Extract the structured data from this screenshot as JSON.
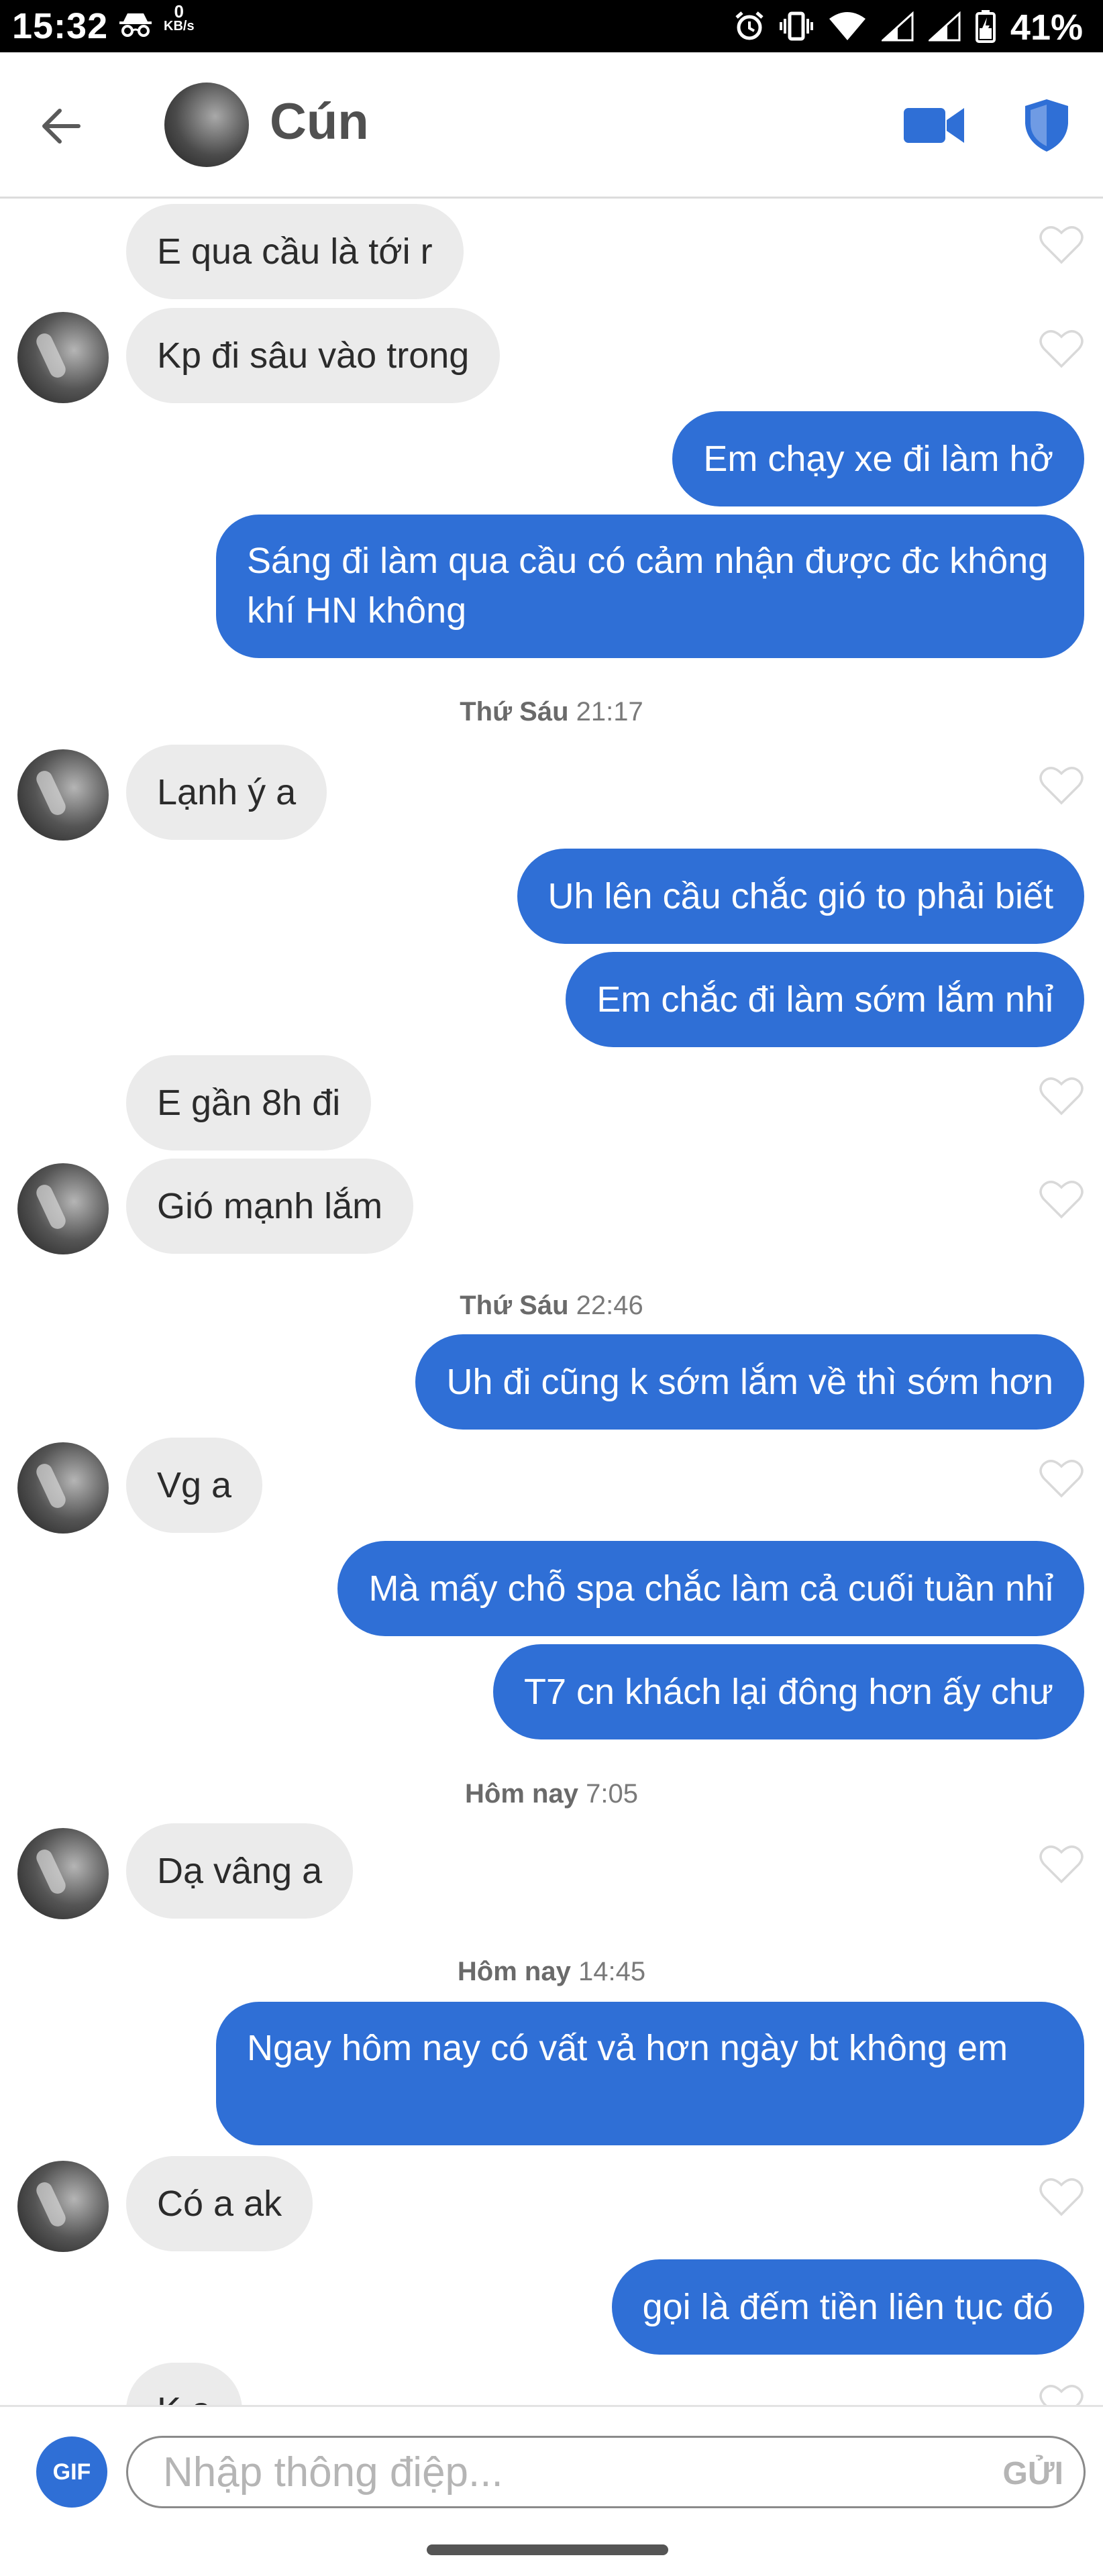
{
  "status_bar": {
    "time": "15:32",
    "speed_value": "0",
    "speed_unit": "KB/s",
    "battery": "41%"
  },
  "header": {
    "contact_name": "Cún",
    "back_icon": "arrow-left-icon",
    "video_icon": "video-camera-icon",
    "safety_icon": "shield-icon"
  },
  "messages": [
    {
      "dir": "in",
      "text": "E qua cầu là tới r"
    },
    {
      "dir": "in",
      "text": "Kp đi sâu vào trong"
    },
    {
      "dir": "out",
      "text": "Em chạy xe đi làm hở"
    },
    {
      "dir": "out",
      "text": "Sáng đi làm qua cầu có cảm nhận được  đc không khí HN không"
    },
    {
      "dir": "ts",
      "day": "Thứ Sáu",
      "time": "21:17"
    },
    {
      "dir": "in",
      "text": "Lạnh ý a"
    },
    {
      "dir": "out",
      "text": "Uh lên cầu chắc gió to phải biết"
    },
    {
      "dir": "out",
      "text": "Em chắc đi làm sớm lắm nhỉ"
    },
    {
      "dir": "in",
      "text": "E gần 8h đi"
    },
    {
      "dir": "in",
      "text": "Gió mạnh lắm"
    },
    {
      "dir": "ts",
      "day": "Thứ Sáu",
      "time": "22:46"
    },
    {
      "dir": "out",
      "text": "Uh đi cũng k sớm lắm về thì sớm hơn"
    },
    {
      "dir": "in",
      "text": "Vg a"
    },
    {
      "dir": "out",
      "text": "Mà mấy chỗ spa chắc làm cả cuối tuần nhỉ"
    },
    {
      "dir": "out",
      "text": "T7 cn khách lại đông hơn ấy chư"
    },
    {
      "dir": "ts",
      "day": "Hôm nay",
      "time": "7:05"
    },
    {
      "dir": "in",
      "text": "Dạ vâng a"
    },
    {
      "dir": "ts",
      "day": "Hôm nay",
      "time": "14:45"
    },
    {
      "dir": "out",
      "text": "Ngay hôm nay có vất vả hơn ngày bt không em"
    },
    {
      "dir": "in",
      "text": "Có a ak"
    },
    {
      "dir": "out",
      "text": "gọi là đếm tiền liên tục đó"
    },
    {
      "dir": "in",
      "text": "K a"
    }
  ],
  "composer": {
    "gif_label": "GIF",
    "placeholder": "Nhập thông điệp...",
    "send_label": "GỬI"
  },
  "colors": {
    "accent": "#2f6fd6",
    "incoming_bubble": "#ebebeb",
    "outgoing_bubble": "#2f6fd6"
  }
}
